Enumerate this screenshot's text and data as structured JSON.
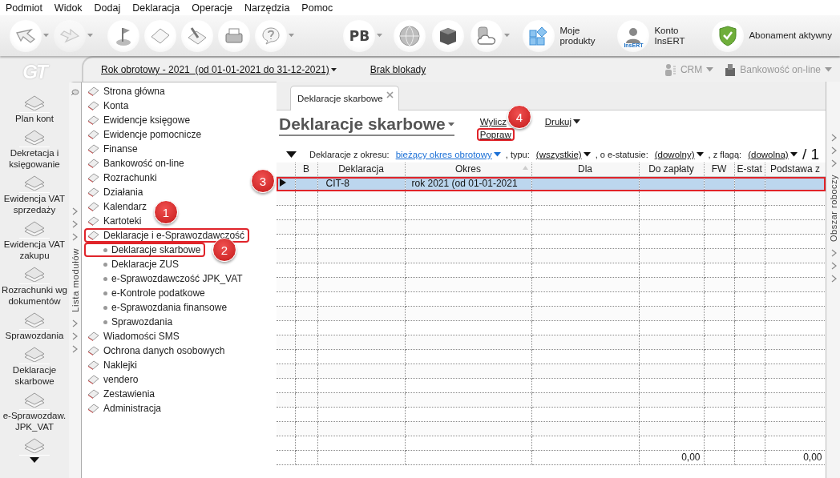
{
  "menu": [
    "Podmiot",
    "Widok",
    "Dodaj",
    "Deklaracja",
    "Operacje",
    "Narzędzia",
    "Pomoc"
  ],
  "toolbar": {
    "left": [
      {
        "dropdown": true,
        "disabled": false
      },
      {
        "dropdown": true,
        "disabled": true
      },
      {
        "dropdown": false,
        "disabled": false
      },
      {
        "dropdown": false,
        "disabled": false
      },
      {
        "dropdown": false,
        "disabled": false
      },
      {
        "dropdown": false,
        "disabled": false
      },
      {
        "dropdown": true,
        "disabled": false
      }
    ],
    "right": [
      {
        "kind": "text",
        "text": "PB",
        "dropdown": true
      },
      {
        "kind": "icon",
        "dropdown": false
      },
      {
        "kind": "icon",
        "dropdown": false
      },
      {
        "kind": "icon",
        "dropdown": true
      },
      {
        "kind": "labeled",
        "label": "Moje produkty"
      },
      {
        "kind": "labeled",
        "label": "Konto InsERT",
        "badge": "InsERT"
      },
      {
        "kind": "labeled",
        "label": "Abonament aktywny"
      }
    ]
  },
  "logo": "GT",
  "rail": [
    "Plan kont",
    "Dekretacja i księgowanie",
    "Ewidencja VAT sprzedaży",
    "Ewidencja VAT zakupu",
    "Rozrachunki wg dokumentów",
    "Sprawozdania",
    "Deklaracje skarbowe",
    "e-Sprawozdaw. JPK_VAT"
  ],
  "period": {
    "label": "Rok obrotowy - 2021  (od 01-01-2021 do 31-12-2021)",
    "lock": "Brak blokady"
  },
  "addons": [
    {
      "label": "CRM",
      "disabled": true
    },
    {
      "label": "Bankowość on-line",
      "disabled": true
    }
  ],
  "modules": {
    "title": "Lista modułów",
    "items": [
      {
        "label": "Strona główna",
        "outlined": false
      },
      {
        "label": "Konta",
        "outlined": false
      },
      {
        "label": "Ewidencje księgowe",
        "outlined": false
      },
      {
        "label": "Ewidencje pomocnicze",
        "outlined": false
      },
      {
        "label": "Finanse",
        "outlined": false
      },
      {
        "label": "Bankowość on-line",
        "outlined": false
      },
      {
        "label": "Rozrachunki",
        "outlined": false
      },
      {
        "label": "Działania",
        "outlined": false
      },
      {
        "label": "Kalendarz",
        "outlined": false
      },
      {
        "label": "Kartoteki",
        "outlined": false
      },
      {
        "label": "Deklaracje i e-Sprawozdawczość",
        "outlined": true,
        "children": [
          {
            "label": "Deklaracje skarbowe",
            "outlined": true
          },
          {
            "label": "Deklaracje ZUS",
            "outlined": false
          },
          {
            "label": "e-Sprawozdawczość JPK_VAT",
            "outlined": false
          },
          {
            "label": "e-Kontrole podatkowe",
            "outlined": false
          },
          {
            "label": "e-Sprawozdania finansowe",
            "outlined": false
          },
          {
            "label": "Sprawozdania",
            "outlined": false
          }
        ]
      },
      {
        "label": "Wiadomości SMS",
        "outlined": false
      },
      {
        "label": "Ochrona danych osobowych",
        "outlined": false
      },
      {
        "label": "Naklejki",
        "outlined": false
      },
      {
        "label": "vendero",
        "outlined": false
      },
      {
        "label": "Zestawienia",
        "outlined": false
      },
      {
        "label": "Administracja",
        "outlined": false
      }
    ]
  },
  "workspace_label": "Obszar roboczy",
  "tabs": [
    {
      "label": "Deklaracje skarbowe",
      "selected": true
    }
  ],
  "view": {
    "title": "Deklaracje skarbowe",
    "actions": [
      {
        "label": "Wylicz",
        "outlined": false,
        "dropdown": false
      },
      {
        "label": "Popraw",
        "outlined": true,
        "dropdown": false
      },
      {
        "label": "Drukuj",
        "outlined": false,
        "dropdown": true
      }
    ]
  },
  "filters": [
    {
      "label": "Deklaracje z okresu:",
      "value": "bieżący okres obrotowy",
      "modified": true
    },
    {
      "label": ", typu:",
      "value": "(wszystkie)",
      "modified": false
    },
    {
      "label": ", o e-statusie:",
      "value": "(dowolny)",
      "modified": false
    },
    {
      "label": ", z flagą:",
      "value": "(dowolna)",
      "modified": false
    }
  ],
  "page_count": "/ 1",
  "table": {
    "columns": [
      {
        "label": "B",
        "sorted": false
      },
      {
        "label": "Deklaracja",
        "sorted": false
      },
      {
        "label": "Okres",
        "sorted": true
      },
      {
        "label": "Dla",
        "sorted": false
      },
      {
        "label": "Do zapłaty",
        "sorted": false
      },
      {
        "label": "FW",
        "sorted": false
      },
      {
        "label": "E-stat",
        "sorted": false
      },
      {
        "label": "Podstawa z",
        "sorted": false
      }
    ],
    "rows": [
      {
        "deklaracja": "CIT-8",
        "okres": "rok 2021 (od 01-01-2021",
        "selected": true,
        "outlined": true
      }
    ],
    "totals": {
      "do_zaplaty": "0,00",
      "podstawa_z": "0,00"
    }
  },
  "callouts": [
    "1",
    "2",
    "3",
    "4"
  ]
}
